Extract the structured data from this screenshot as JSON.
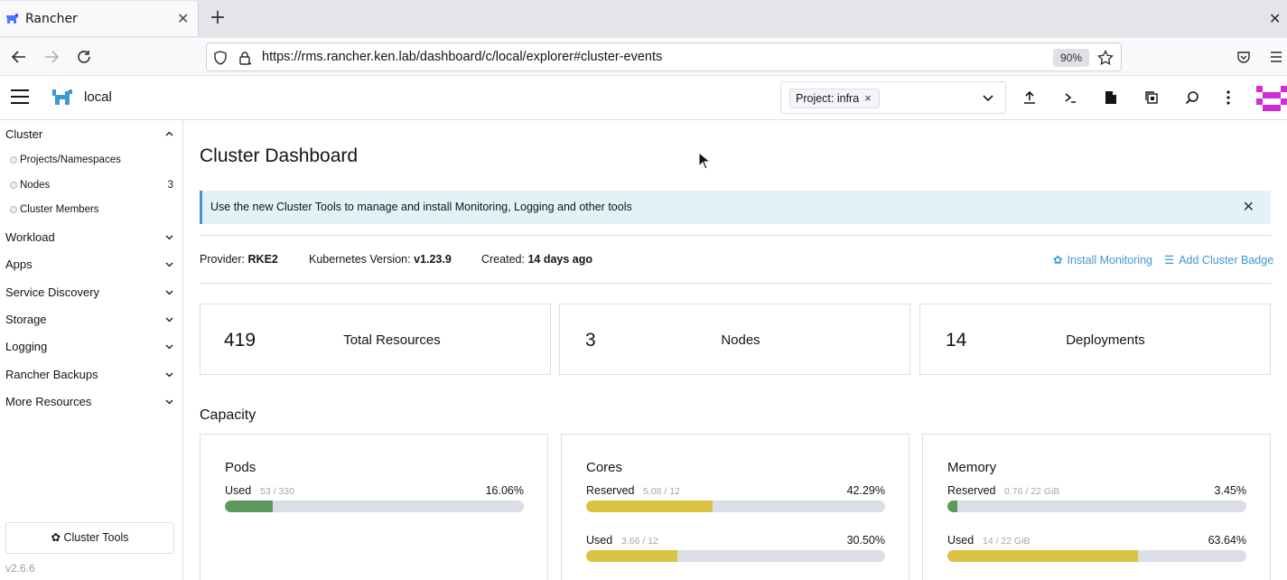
{
  "browser": {
    "tab_title": "Rancher",
    "url": "https://rms.rancher.ken.lab/dashboard/c/local/explorer#cluster-events",
    "zoom": "90%"
  },
  "header": {
    "cluster_name": "local",
    "namespace_filter_chip": "Project: infra"
  },
  "sidebar": {
    "groups": [
      {
        "label": "Cluster",
        "expanded": true
      },
      {
        "label": "Workload"
      },
      {
        "label": "Apps"
      },
      {
        "label": "Service Discovery"
      },
      {
        "label": "Storage"
      },
      {
        "label": "Logging"
      },
      {
        "label": "Rancher Backups"
      },
      {
        "label": "More Resources"
      }
    ],
    "cluster_items": [
      {
        "label": "Projects/Namespaces",
        "count": ""
      },
      {
        "label": "Nodes",
        "count": "3"
      },
      {
        "label": "Cluster Members",
        "count": ""
      }
    ],
    "cluster_tools_label": "Cluster Tools",
    "version": "v2.6.6"
  },
  "main": {
    "title": "Cluster Dashboard",
    "banner": "Use the new Cluster Tools to manage and install Monitoring, Logging and other tools",
    "provider_label": "Provider:",
    "provider_value": "RKE2",
    "k8s_label": "Kubernetes Version:",
    "k8s_value": "v1.23.9",
    "created_label": "Created:",
    "created_value": "14 days ago",
    "install_monitoring": "Install Monitoring",
    "add_cluster_badge": "Add Cluster Badge",
    "stats": [
      {
        "value": "419",
        "label": "Total Resources"
      },
      {
        "value": "3",
        "label": "Nodes"
      },
      {
        "value": "14",
        "label": "Deployments"
      }
    ],
    "capacity_title": "Capacity",
    "capacity": [
      {
        "name": "Pods",
        "rows": [
          {
            "label": "Used",
            "sub": "53 / 330",
            "pct": "16.06%",
            "fraction": 0.1606,
            "color": "#5d995d"
          }
        ]
      },
      {
        "name": "Cores",
        "rows": [
          {
            "label": "Reserved",
            "sub": "5.08 / 12",
            "pct": "42.29%",
            "fraction": 0.4229,
            "color": "#dac342"
          },
          {
            "label": "Used",
            "sub": "3.66 / 12",
            "pct": "30.50%",
            "fraction": 0.305,
            "color": "#dac342"
          }
        ]
      },
      {
        "name": "Memory",
        "rows": [
          {
            "label": "Reserved",
            "sub": "0.76 / 22 GiB",
            "pct": "3.45%",
            "fraction": 0.0345,
            "color": "#5d995d"
          },
          {
            "label": "Used",
            "sub": "14 / 22 GiB",
            "pct": "63.64%",
            "fraction": 0.6364,
            "color": "#dac342"
          }
        ]
      }
    ]
  },
  "colors": {
    "accent": "#3d98d3",
    "banner_bg": "#e3f2f9",
    "ok": "#5d995d",
    "warn": "#dac342"
  }
}
